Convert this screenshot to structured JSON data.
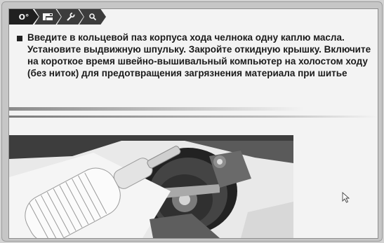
{
  "tabs": [
    {
      "label": "O°",
      "icon": "settings-icon"
    },
    {
      "label": "",
      "icon": "machine-icon"
    },
    {
      "label": "",
      "icon": "wrench-icon"
    },
    {
      "label": "",
      "icon": "search-icon"
    }
  ],
  "instruction_text": "Введите в кольцевой паз корпуса хода челнока одну каплю масла. Установите выдвижную шпульку. Закройте откидную крышку. Включите на короткое время швейно-вышивальный компьютер на холостом ходу (без ниток) для предотвращения загрязнения материала при шитье",
  "colors": {
    "tab_bg": "#3c3c3c",
    "panel_bg": "#f3f3f3",
    "text": "#1b1b1b"
  }
}
